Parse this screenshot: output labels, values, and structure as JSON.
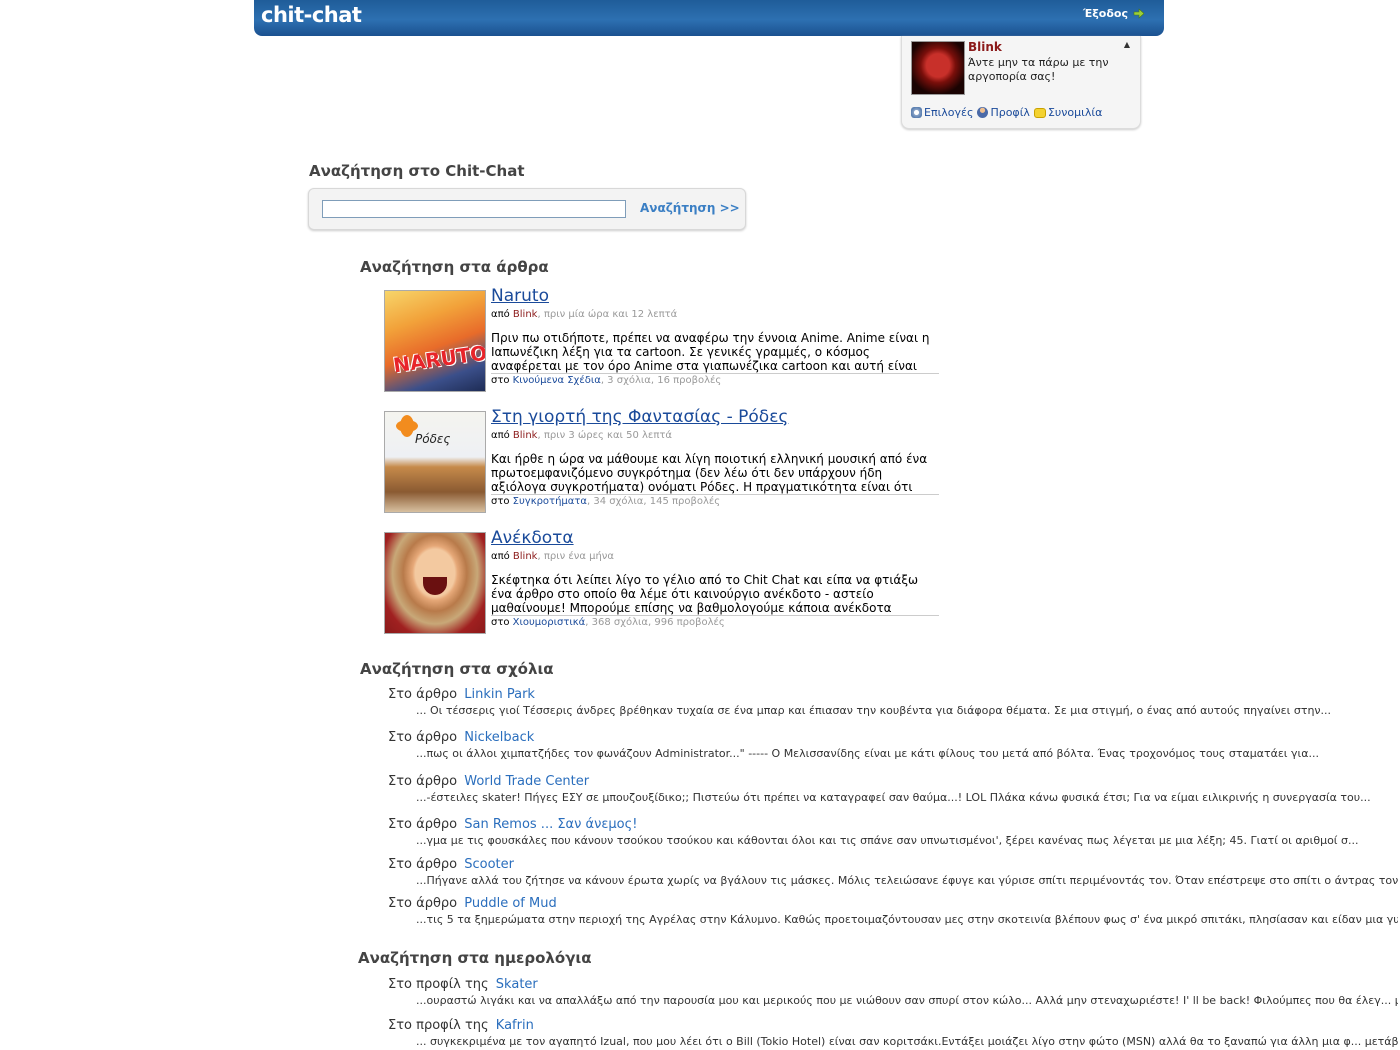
{
  "header": {
    "logo": "chit-chat",
    "exit_label": "Έξοδος"
  },
  "userbox": {
    "username": "Blink",
    "status": "Άντε μην τα πάρω με την αργοπορία σας!",
    "links": [
      "Επιλογές",
      "Προφίλ",
      "Συνομιλία"
    ]
  },
  "search": {
    "title": "Αναζήτηση στο Chit-Chat",
    "input_value": "",
    "button_label": "Αναζήτηση >>"
  },
  "articles_section": {
    "title": "Αναζήτηση στα άρθρα",
    "items": [
      {
        "title": "Naruto",
        "by": "από",
        "author": "Blink",
        "time": ", πριν μία ώρα και 12 λεπτά",
        "excerpt": "Πριν πω οτιδήποτε, πρέπει να αναφέρω την έννοια Anime. Anime είναι η Ιαπωνέζικη λέξη για τα cartoon. Σε γενικές γραμμές, ο κόσμος αναφέρεται με τον όρο Anime στα γιαπωνέζικα cartoon και αυτή είναι",
        "in": "στο",
        "category": "Κινούμενα Σχέδια",
        "stats": ", 3 σχόλια, 16 προβολές",
        "thumb_text": "NARUTO"
      },
      {
        "title": "Στη γιορτή της Φαντασίας - Ρόδες",
        "by": "από",
        "author": "Blink",
        "time": ", πριν 3 ώρες και 50 λεπτά",
        "excerpt": "Και ήρθε η ώρα να μάθουμε και λίγη ποιοτική ελληνική μουσική από ένα πρωτοεμφανιζόμενο συγκρότημα (δεν λέω ότι δεν υπάρχουν ήδη αξιόλογα συγκροτήματα) ονόματι Ρόδες. Η πραγματικότητα είναι ότι",
        "in": "στο",
        "category": "Συγκροτήματα",
        "stats": ", 34 σχόλια, 145 προβολές",
        "thumb_text": "Ρόδες"
      },
      {
        "title": "Ανέκδοτα",
        "by": "από",
        "author": "Blink",
        "time": ", πριν ένα μήνα",
        "excerpt": "Σκέφτηκα ότι λείπει λίγο το γέλιο από το Chit Chat και είπα να φτιάξω ένα άρθρο στο οποίο θα λέμε ότι καινούργιο ανέκδοτο - αστείο μαθαίνουμε! Μπορούμε επίσης να βαθμολογούμε κάποια ανέκδοτα",
        "in": "στο",
        "category": "Χιουμοριστικά",
        "stats": ", 368 σχόλια, 996 προβολές",
        "thumb_text": ""
      }
    ]
  },
  "comments_section": {
    "title": "Αναζήτηση στα σχόλια",
    "items": [
      {
        "prefix": "Στο άρθρο",
        "link": "Linkin Park",
        "text": "... Οι τέσσερις γιοί Τέσσερις άνδρες βρέθηκαν τυχαία σε ένα μπαρ και έπιασαν την κουβέντα για διάφορα θέματα. Σε μια στιγμή, ο ένας από αυτούς πηγαίνει στην..."
      },
      {
        "prefix": "Στο άρθρο",
        "link": "Nickelback",
        "text": "...πως οι άλλοι χιμπατζήδες τον φωνάζουν Administrator...\" ----- Ο Μελισσανίδης είναι με κάτι φίλους του μετά από βόλτα. Ένας τροχονόμος τους σταματάει για..."
      },
      {
        "prefix": "Στο άρθρο",
        "link": "World Trade Center",
        "text": "...-έστειλες skater! Πήγες ΕΣΥ σε μπουζουξίδικο;; Πιστεύω ότι πρέπει να καταγραφεί σαν θαύμα...! LOL Πλάκα κάνω φυσικά έτσι; Για να είμαι ειλικρινής η συνεργασία του..."
      },
      {
        "prefix": "Στο άρθρο",
        "link": "San Remos ... Σαν άνεμος!",
        "text": "...γμα με τις φουσκάλες που κάνουν τσούκου τσούκου και κάθονται όλοι και τις σπάνε σαν υπνωτισμένοι', ξέρει κανένας πως λέγεται με μια λέξη; 45. Γιατί οι αριθμοί σ..."
      },
      {
        "prefix": "Στο άρθρο",
        "link": "Scooter",
        "text": "...Πήγανε αλλά του ζήτησε να κάνουν έρωτα χωρίς να βγάλουν τις μάσκες. Μόλις τελειώσανε έφυγε και γύρισε σπίτι περιμένοντάς τον. Όταν επέστρεψε στο σπίτι ο άντρας τον..."
      },
      {
        "prefix": "Στο άρθρο",
        "link": "Puddle of Mud",
        "text": "...τις 5 τα ξημερώματα στην περιοχή της Αγρέλας στην Κάλυμνο. Καθώς προετοιμαζόντουσαν μες στην σκοτεινία βλέπουν φως σ' ένα μικρό σπιτάκι, πλησίασαν και είδαν μια γυ..."
      }
    ]
  },
  "blogs_section": {
    "title": "Αναζήτηση στα ημερολόγια",
    "items": [
      {
        "prefix": "Στο προφίλ της",
        "link": "Skater",
        "text": "...ουραστώ λιγάκι και να απαλλάξω από την παρουσία μου και μερικούς που με νιώθουν σαν σπυρί στον κώλο... Αλλά μην στεναχωριέστε! I' ll be back! Φιλούμπες που θα έλεγ... μετάβ"
      },
      {
        "prefix": "Στο προφίλ της",
        "link": "Kafrin",
        "text": "... συγκεκριμένα με τον αγαπητό Izual, που μου λέει ότι ο Bill (Tokio Hotel) είναι σαν κοριτσάκι.Εντάξει μοιάζει λίγο στην φώτο (MSN) αλλά θα το ξαναπώ για άλλη μια φ... μετάβαση"
      }
    ]
  }
}
